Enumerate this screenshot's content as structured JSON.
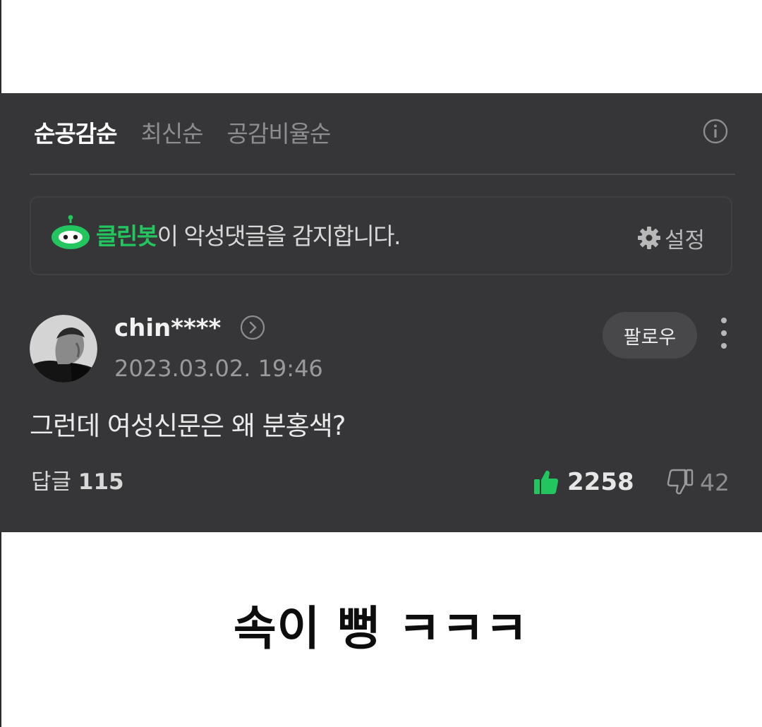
{
  "sort_tabs": [
    {
      "label": "순공감순",
      "active": true
    },
    {
      "label": "최신순",
      "active": false
    },
    {
      "label": "공감비율순",
      "active": false
    }
  ],
  "cleanbot": {
    "name": "클린봇",
    "message": "이 악성댓글을 감지합니다.",
    "settings_label": "설정"
  },
  "comment": {
    "username": "chin****",
    "timestamp": "2023.03.02. 19:46",
    "follow_label": "팔로우",
    "body": "그런데 여성신문은 왜 분홍색?",
    "reply_label": "답글",
    "reply_count": "115",
    "like_count": "2258",
    "dislike_count": "42"
  },
  "caption": "속이 뻥 ㅋㅋㅋ",
  "colors": {
    "panel_background": "#363638",
    "accent_green": "#22c55e",
    "follow_button": "#48484b"
  },
  "icons": [
    "info-icon",
    "cleanbot-robot-icon",
    "gear-icon",
    "chevron-right-icon",
    "more-vertical-icon",
    "thumbs-up-icon",
    "thumbs-down-icon"
  ]
}
